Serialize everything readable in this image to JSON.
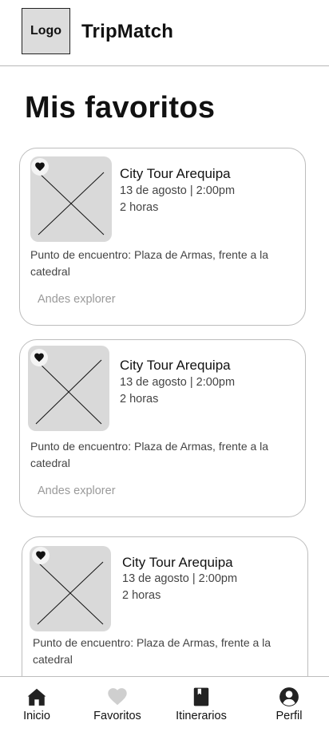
{
  "header": {
    "logo_text": "Logo",
    "app_title": "TripMatch"
  },
  "page_title": "Mis favoritos",
  "cards": [
    {
      "title": "City Tour Arequipa",
      "date": "13 de agosto | 2:00pm",
      "duration": "2 horas",
      "meeting_point": "Punto de encuentro: Plaza de Armas, frente a la catedral",
      "provider": "Andes explorer",
      "favorited": true
    },
    {
      "title": "City Tour Arequipa",
      "date": "13 de agosto | 2:00pm",
      "duration": "2 horas",
      "meeting_point": "Punto de encuentro: Plaza de Armas, frente a la catedral",
      "provider": "Andes explorer",
      "favorited": true
    },
    {
      "title": "City Tour Arequipa",
      "date": "13 de agosto | 2:00pm",
      "duration": "2 horas",
      "meeting_point": "Punto de encuentro: Plaza de Armas, frente a la catedral",
      "favorited": true
    }
  ],
  "bottom_nav": {
    "active": "Favoritos",
    "items": [
      {
        "label": "Inicio",
        "icon": "home-icon"
      },
      {
        "label": "Favoritos",
        "icon": "heart-icon"
      },
      {
        "label": "Itinerarios",
        "icon": "book-icon"
      },
      {
        "label": "Perfil",
        "icon": "user-icon"
      }
    ]
  },
  "colors": {
    "placeholder_gray": "#d9d9d9",
    "border_gray": "#bdbdbd",
    "inactive_icon": "#cfcfcf",
    "text_dark": "#111111",
    "text_muted": "#9a9a9a"
  }
}
